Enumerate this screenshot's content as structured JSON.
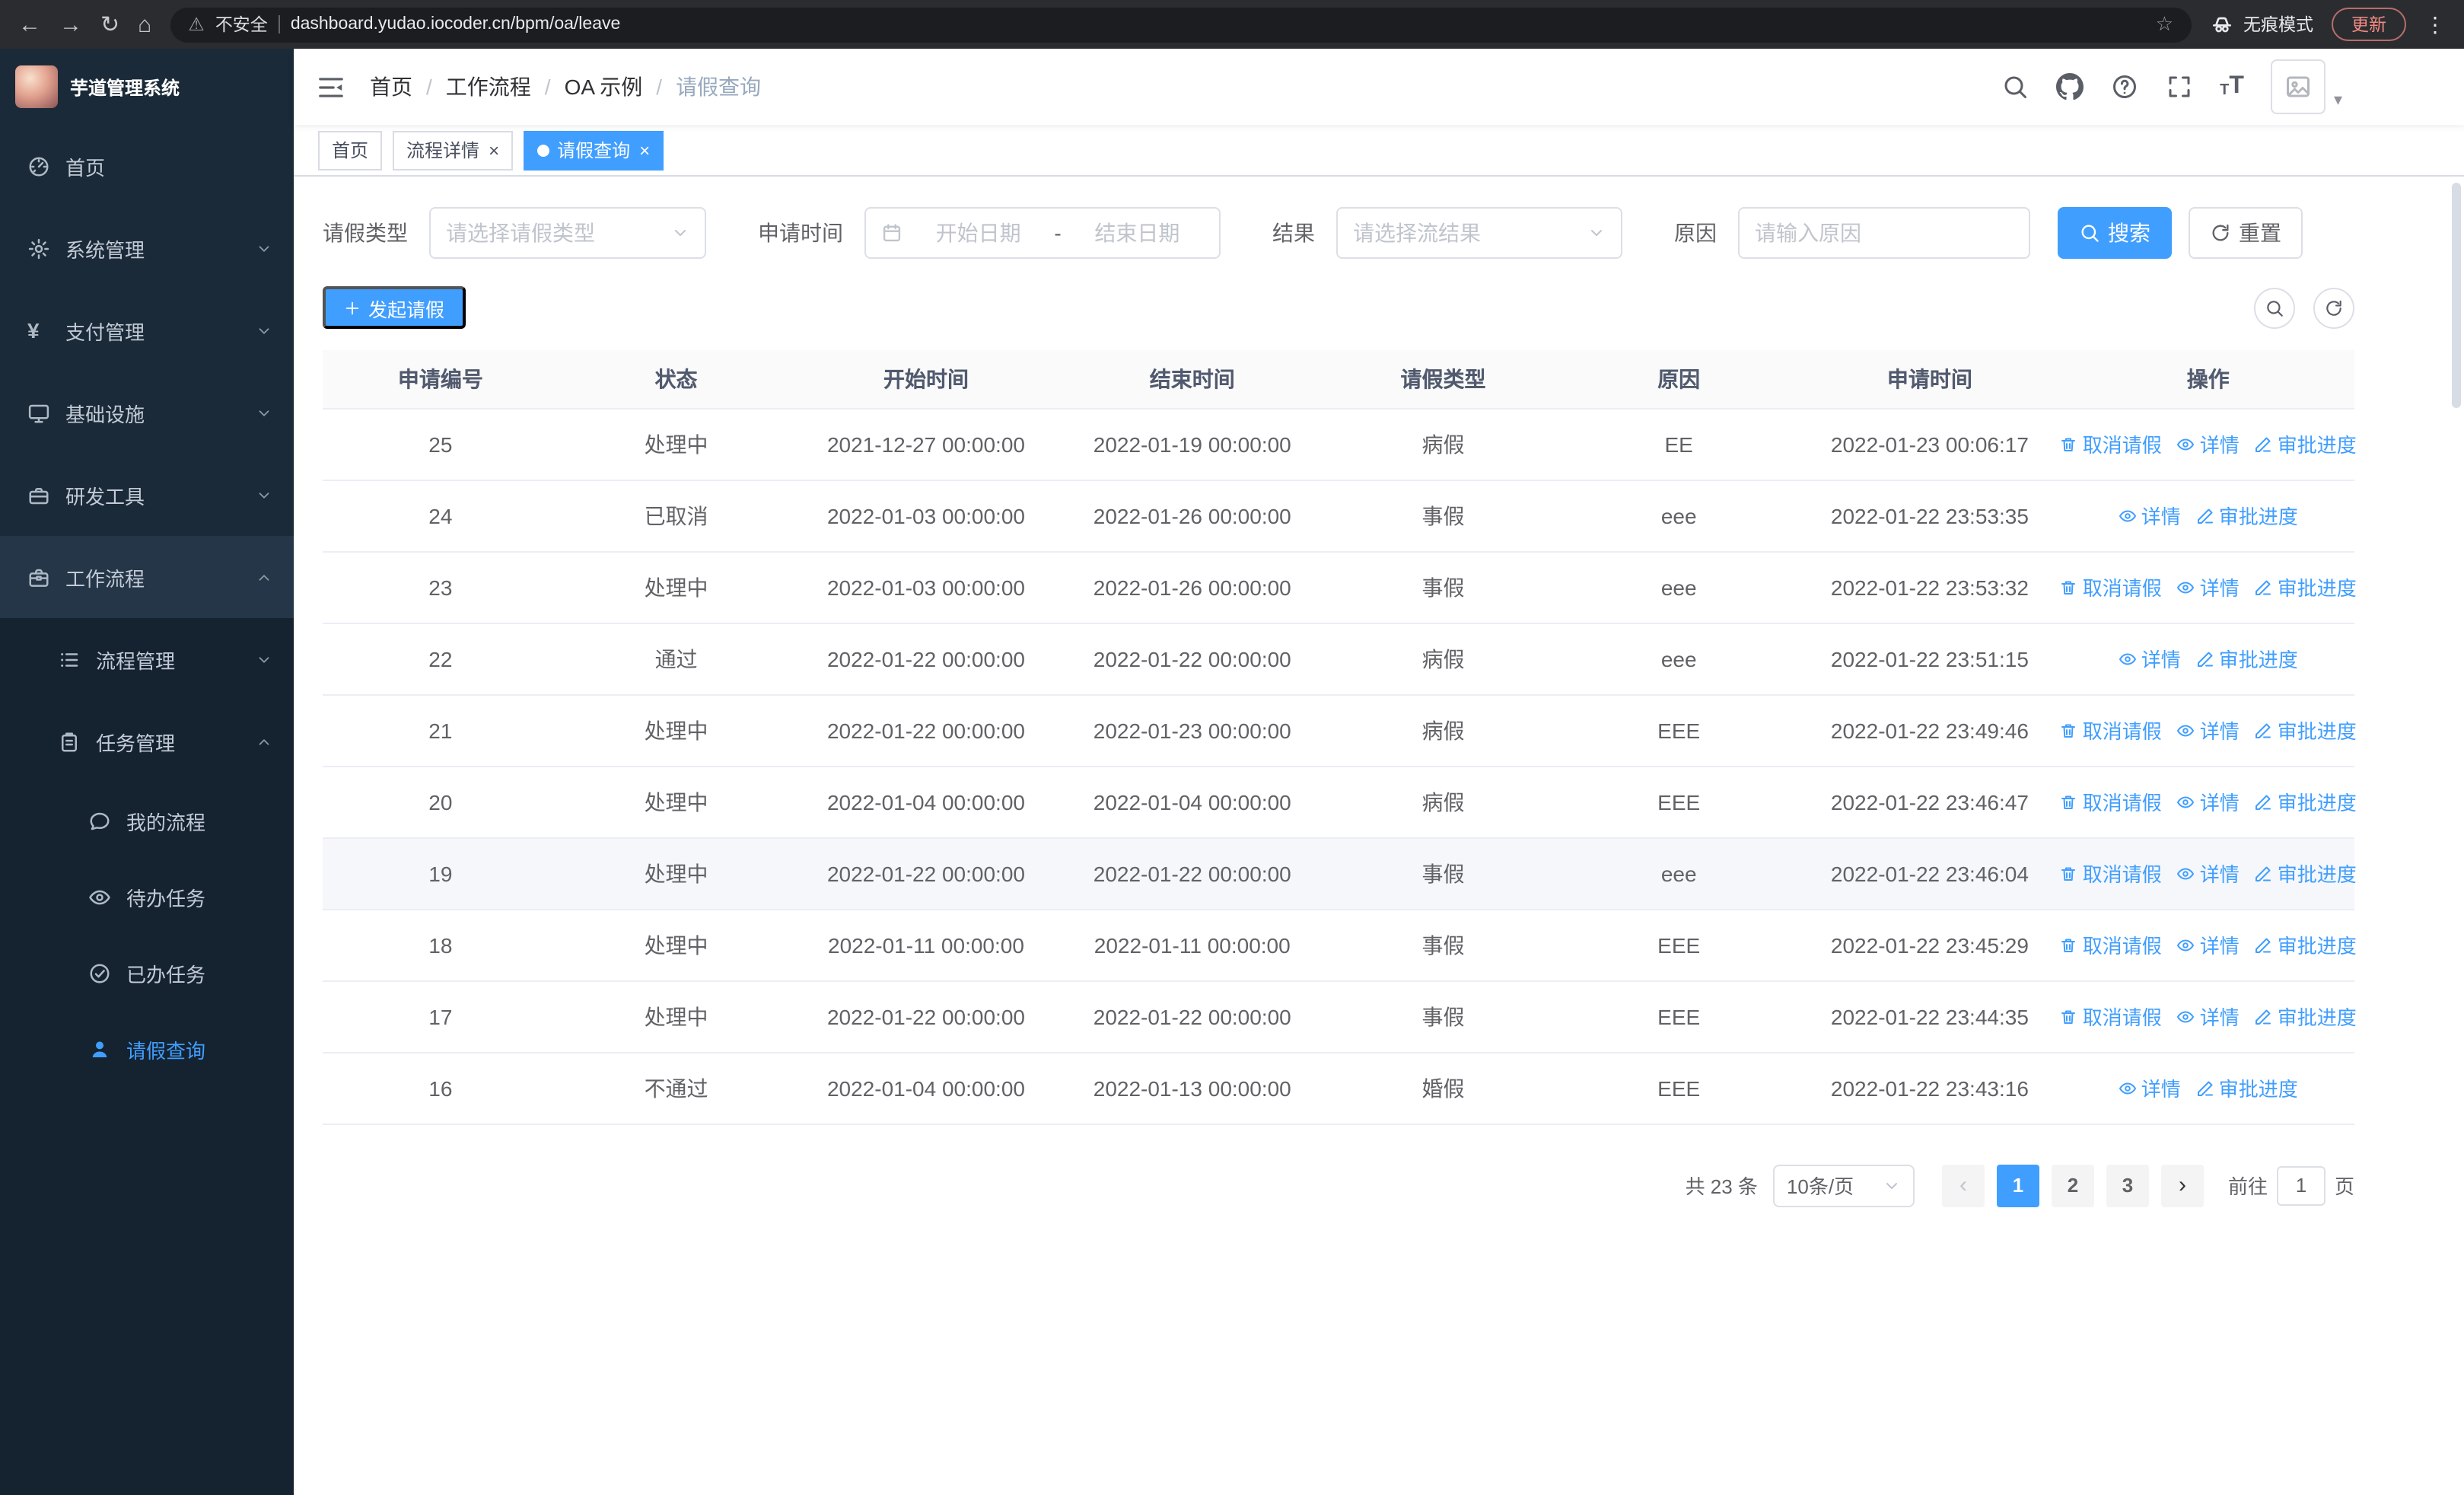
{
  "browser": {
    "security_warning": "不安全",
    "url": "dashboard.yudao.iocoder.cn/bpm/oa/leave",
    "incognito_label": "无痕模式",
    "update_label": "更新"
  },
  "sidebar": {
    "logo_title": "芋道管理系统",
    "menu": [
      {
        "key": "home",
        "label": "首页",
        "icon": "dashboard-icon",
        "level": 1
      },
      {
        "key": "system",
        "label": "系统管理",
        "icon": "gear-icon",
        "level": 1,
        "chevron": "down"
      },
      {
        "key": "payment",
        "label": "支付管理",
        "icon": "yen-icon",
        "level": 1,
        "chevron": "down"
      },
      {
        "key": "infrastructure",
        "label": "基础设施",
        "icon": "monitor-icon",
        "level": 1,
        "chevron": "down"
      },
      {
        "key": "dev-tools",
        "label": "研发工具",
        "icon": "toolbox-icon",
        "level": 1,
        "chevron": "down"
      },
      {
        "key": "workflow",
        "label": "工作流程",
        "icon": "briefcase-icon",
        "level": 1,
        "chevron": "up",
        "open": true
      },
      {
        "key": "process-management",
        "label": "流程管理",
        "icon": "list-icon",
        "level": 2,
        "chevron": "down"
      },
      {
        "key": "task-management",
        "label": "任务管理",
        "icon": "clipboard-icon",
        "level": 2,
        "chevron": "up"
      },
      {
        "key": "my-process",
        "label": "我的流程",
        "icon": "chat-icon",
        "level": 3
      },
      {
        "key": "todo-tasks",
        "label": "待办任务",
        "icon": "eye-icon",
        "level": 3
      },
      {
        "key": "done-tasks",
        "label": "已办任务",
        "icon": "check-circle-icon",
        "level": 3
      },
      {
        "key": "leave-query",
        "label": "请假查询",
        "icon": "user-icon",
        "level": 3,
        "active": true
      }
    ]
  },
  "header": {
    "breadcrumb": [
      {
        "key": "home",
        "label": "首页"
      },
      {
        "key": "workflow",
        "label": "工作流程"
      },
      {
        "key": "oa-example",
        "label": "OA 示例"
      },
      {
        "key": "leave-query",
        "label": "请假查询",
        "current": true
      }
    ]
  },
  "tabs": [
    {
      "key": "home",
      "label": "首页",
      "closable": false,
      "active": false
    },
    {
      "key": "process-detail",
      "label": "流程详情",
      "closable": true,
      "active": false
    },
    {
      "key": "leave-query",
      "label": "请假查询",
      "closable": true,
      "active": true
    }
  ],
  "filters": {
    "leave_type_label": "请假类型",
    "leave_type_placeholder": "请选择请假类型",
    "apply_time_label": "申请时间",
    "start_date_placeholder": "开始日期",
    "range_separator": "-",
    "end_date_placeholder": "结束日期",
    "result_label": "结果",
    "result_placeholder": "请选择流结果",
    "reason_label": "原因",
    "reason_placeholder": "请输入原因",
    "search_label": "搜索",
    "reset_label": "重置"
  },
  "toolbar": {
    "create_label": "发起请假"
  },
  "table": {
    "columns": [
      "申请编号",
      "状态",
      "开始时间",
      "结束时间",
      "请假类型",
      "原因",
      "申请时间",
      "操作"
    ],
    "action_labels": {
      "cancel": "取消请假",
      "detail": "详情",
      "progress": "审批进度"
    },
    "rows": [
      {
        "id": "25",
        "status": "处理中",
        "start": "2021-12-27 00:00:00",
        "end": "2022-01-19 00:00:00",
        "type": "病假",
        "reason": "EE",
        "applied": "2022-01-23 00:06:17",
        "cancellable": true,
        "highlighted": false
      },
      {
        "id": "24",
        "status": "已取消",
        "start": "2022-01-03 00:00:00",
        "end": "2022-01-26 00:00:00",
        "type": "事假",
        "reason": "eee",
        "applied": "2022-01-22 23:53:35",
        "cancellable": false,
        "highlighted": false
      },
      {
        "id": "23",
        "status": "处理中",
        "start": "2022-01-03 00:00:00",
        "end": "2022-01-26 00:00:00",
        "type": "事假",
        "reason": "eee",
        "applied": "2022-01-22 23:53:32",
        "cancellable": true,
        "highlighted": false
      },
      {
        "id": "22",
        "status": "通过",
        "start": "2022-01-22 00:00:00",
        "end": "2022-01-22 00:00:00",
        "type": "病假",
        "reason": "eee",
        "applied": "2022-01-22 23:51:15",
        "cancellable": false,
        "highlighted": false
      },
      {
        "id": "21",
        "status": "处理中",
        "start": "2022-01-22 00:00:00",
        "end": "2022-01-23 00:00:00",
        "type": "病假",
        "reason": "EEE",
        "applied": "2022-01-22 23:49:46",
        "cancellable": true,
        "highlighted": false
      },
      {
        "id": "20",
        "status": "处理中",
        "start": "2022-01-04 00:00:00",
        "end": "2022-01-04 00:00:00",
        "type": "病假",
        "reason": "EEE",
        "applied": "2022-01-22 23:46:47",
        "cancellable": true,
        "highlighted": false
      },
      {
        "id": "19",
        "status": "处理中",
        "start": "2022-01-22 00:00:00",
        "end": "2022-01-22 00:00:00",
        "type": "事假",
        "reason": "eee",
        "applied": "2022-01-22 23:46:04",
        "cancellable": true,
        "highlighted": true
      },
      {
        "id": "18",
        "status": "处理中",
        "start": "2022-01-11 00:00:00",
        "end": "2022-01-11 00:00:00",
        "type": "事假",
        "reason": "EEE",
        "applied": "2022-01-22 23:45:29",
        "cancellable": true,
        "highlighted": false
      },
      {
        "id": "17",
        "status": "处理中",
        "start": "2022-01-22 00:00:00",
        "end": "2022-01-22 00:00:00",
        "type": "事假",
        "reason": "EEE",
        "applied": "2022-01-22 23:44:35",
        "cancellable": true,
        "highlighted": false
      },
      {
        "id": "16",
        "status": "不通过",
        "start": "2022-01-04 00:00:00",
        "end": "2022-01-13 00:00:00",
        "type": "婚假",
        "reason": "EEE",
        "applied": "2022-01-22 23:43:16",
        "cancellable": false,
        "highlighted": false
      }
    ]
  },
  "pagination": {
    "total_label": "共 23 条",
    "page_size_label": "10条/页",
    "pages": [
      "1",
      "2",
      "3"
    ],
    "active_page": "1",
    "goto_label": "前往",
    "goto_value": "1",
    "page_unit_label": "页"
  },
  "colors": {
    "accent": "#409eff",
    "sidebar_bg": "#1b2a38",
    "submenu_bg": "#152330",
    "chrome_bg": "#2b2c30",
    "tab_active_bg": "#409eff"
  }
}
